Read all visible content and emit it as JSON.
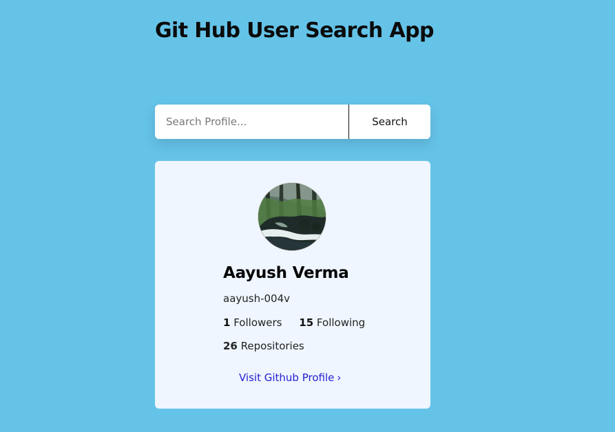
{
  "header": {
    "title": "Git Hub User Search App"
  },
  "search": {
    "placeholder": "Search Profile...",
    "button_label": "Search"
  },
  "profile": {
    "name": "Aayush Verma",
    "username": "aayush-004v",
    "followers_count": "1",
    "followers_label": "Followers",
    "following_count": "15",
    "following_label": "Following",
    "repositories_count": "26",
    "repositories_label": "Repositories",
    "visit_link_label": "Visit Github Profile",
    "visit_link_icon": "chevron-right-icon"
  },
  "colors": {
    "page_background": "#65c3e8",
    "card_background": "#eff6ff",
    "link": "#2320cf"
  }
}
